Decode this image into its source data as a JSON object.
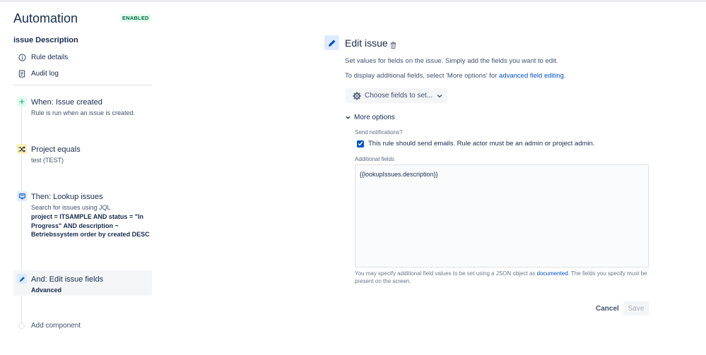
{
  "app": {
    "title": "Automation",
    "status_badge": "ENABLED"
  },
  "sidebar": {
    "rule_name": "issue Description",
    "links": [
      {
        "label": "Rule details",
        "icon": "info-icon"
      },
      {
        "label": "Audit log",
        "icon": "audit-log-icon"
      }
    ],
    "steps": [
      {
        "title": "When: Issue created",
        "desc": "Rule is run when an issue is created.",
        "icon": "plus-icon",
        "color": "#36b37e"
      },
      {
        "title": "Project equals",
        "desc": "test (TEST)",
        "icon": "shuffle-icon",
        "color": "#ffab00"
      },
      {
        "title": "Then: Lookup issues",
        "desc": "Search for issues using JQL",
        "bold": "project = ITSAMPLE AND status = \"In Progress\" AND description ~ Betriebssystem order by created DESC",
        "icon": "lookup-icon",
        "color": "#0065ff"
      },
      {
        "title": "And: Edit issue fields",
        "bold": "Advanced",
        "icon": "pencil-icon",
        "color": "#0065ff"
      }
    ],
    "add_component": "Add component"
  },
  "editor": {
    "title": "Edit issue",
    "description": "Set values for fields on the issue. Simply add the fields you want to edit.",
    "additional_prefix": "To display additional fields, select 'More options' for",
    "additional_link": "advanced field editing",
    "additional_suffix": ".",
    "choose_fields_label": "Choose fields to set...",
    "more_options_label": "More options",
    "send_notifications_label": "Send notifications?",
    "checkbox_label": "This rule should send emails. Rule actor must be an admin or project admin.",
    "checkbox_checked": true,
    "additional_fields_label": "Additional fields",
    "additional_fields_value": "{{lookupIssues.description}}",
    "help_prefix": "You may specify additional field values to be set using a JSON object as",
    "help_link": "documented",
    "help_suffix": ". The fields you specify must be present on the screen.",
    "cancel_label": "Cancel",
    "save_label": "Save"
  },
  "colors": {
    "accent": "#0052cc",
    "badge_bg": "#e3fcef",
    "badge_text": "#006644"
  }
}
